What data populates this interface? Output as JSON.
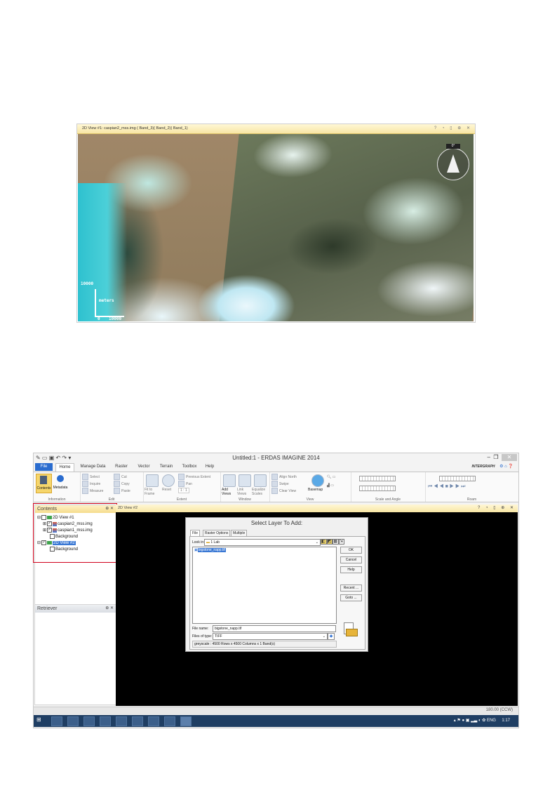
{
  "view1": {
    "title": "2D View #1: caspian2_mss.img ( Band_3)( Band_2)( Band_1)",
    "compass_label": "0°",
    "scale_value_top": "10000",
    "scale_unit": "meters",
    "scale_value_bottom": "10000",
    "scale_zero": "0"
  },
  "app": {
    "title": "Untitled:1 - ERDAS IMAGINE 2014",
    "brand": "INTERGRAPH",
    "tabs": [
      "File",
      "Home",
      "Manage Data",
      "Raster",
      "Vector",
      "Terrain",
      "Toolbox",
      "Help"
    ],
    "ribbon": {
      "contents": "Contents",
      "metadata": "Metadata",
      "group_information": "Information",
      "select": "Select",
      "inquire": "Inquire",
      "measure": "Measure",
      "cut": "Cut",
      "copy": "Copy",
      "paste": "Paste",
      "group_edit": "Edit",
      "fit_to_frame": "Fit to Frame",
      "reset": "Reset",
      "previous_extent": "Previous Extent",
      "pan": "Pan",
      "one_to_one": "1 : 1",
      "group_extent": "Extent",
      "add_views": "Add Views",
      "link_views": "Link Views",
      "equalize_scales": "Equalize Scales",
      "group_window": "Window",
      "align_north": "Align North",
      "swipe": "Swipe",
      "clear_view": "Clear View",
      "basemap": "Basemap",
      "group_view": "View",
      "group_scale_angle": "Scale and Angle",
      "group_roam": "Roam"
    },
    "contents_panel": {
      "title": "Contents",
      "items": [
        "2D View #1",
        "caspian2_mss.img",
        "caspian1_mss.img",
        "Background",
        "2D View #2",
        "Background"
      ]
    },
    "retriever_panel": {
      "title": "Retriever"
    },
    "view2_title": "2D View #2",
    "status_right": "180.00 (CCW)",
    "tray": {
      "lang": "ENG",
      "time": "1:17"
    }
  },
  "dialog": {
    "title": "Select Layer To Add:",
    "tabs": [
      "File",
      "Raster Options",
      "Multiple"
    ],
    "look_in_label": "Look in:",
    "look_in_value": "1 Lab",
    "file_item": "bigstone_napp.tif",
    "buttons": {
      "ok": "OK",
      "cancel": "Cancel",
      "help": "Help",
      "recent": "Recent ...",
      "goto": "Goto ..."
    },
    "file_name_label": "File name:",
    "file_name_value": "bigstone_napp.tif",
    "files_of_type_label": "Files of type:",
    "files_of_type_value": "TIFF",
    "info": "greyscale : 4500 Rows x 4500 Columns x 1 Band(s)"
  },
  "colors": {
    "ribbon_file_tab": "#2a6ccf",
    "highlight": "#d0021b",
    "panel_header": "#f5dc8c",
    "taskbar": "#1f3e63"
  }
}
